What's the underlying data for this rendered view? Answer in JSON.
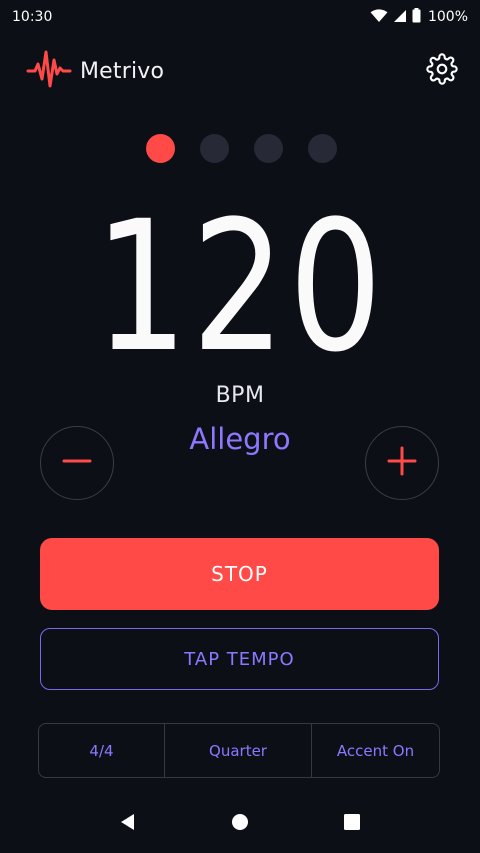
{
  "status_bar": {
    "time": "10:30",
    "battery": "100%",
    "icons": [
      "wifi-icon",
      "cell-signal-icon",
      "battery-icon"
    ]
  },
  "app": {
    "name": "Metrivo",
    "logo_icon": "waveform-icon",
    "settings_icon": "gear-icon"
  },
  "beats": {
    "count": 4,
    "active_index": 0
  },
  "tempo": {
    "value": "120",
    "unit": "BPM",
    "name": "Allegro"
  },
  "controls": {
    "decrease_icon": "minus-icon",
    "increase_icon": "plus-icon",
    "stop_label": "STOP",
    "tap_label": "TAP TEMPO"
  },
  "options": {
    "time_signature": "4/4",
    "subdivision": "Quarter",
    "accent": "Accent On"
  },
  "navigation": {
    "icons": [
      "back-icon",
      "home-icon",
      "recents-icon"
    ]
  },
  "colors": {
    "background": "#0d0f17",
    "accent_red": "#ff4a47",
    "accent_purple": "#8c78ff",
    "inactive_dot": "#272936"
  }
}
